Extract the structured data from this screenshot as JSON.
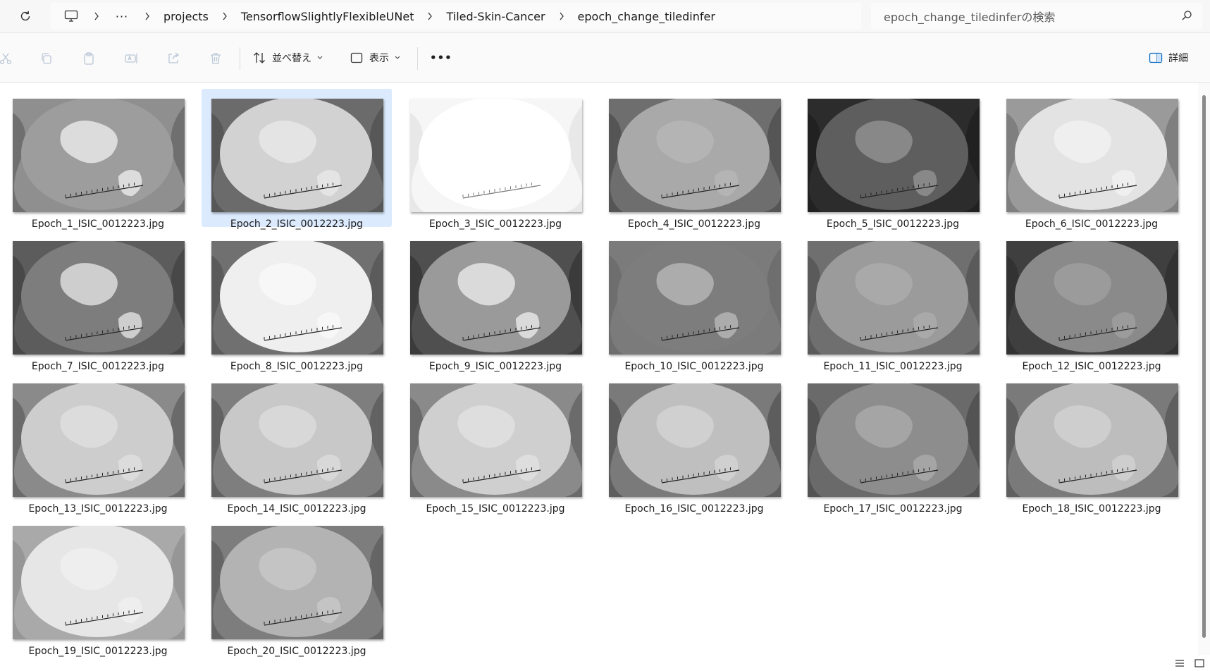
{
  "breadcrumb": {
    "overflow": "···",
    "items": [
      "projects",
      "TensorflowSlightlyFlexibleUNet",
      "Tiled-Skin-Cancer",
      "epoch_change_tiledinfer"
    ]
  },
  "search": {
    "placeholder": "epoch_change_tiledinferの検索"
  },
  "toolbar": {
    "sort_label": "並べ替え",
    "view_label": "表示",
    "more_label": "•••",
    "details_label": "詳細"
  },
  "files": [
    {
      "name": "Epoch_1_ISIC_0012223.jpg",
      "style": "e1"
    },
    {
      "name": "Epoch_2_ISIC_0012223.jpg",
      "style": "e2",
      "selected": true
    },
    {
      "name": "Epoch_3_ISIC_0012223.jpg",
      "style": "e3"
    },
    {
      "name": "Epoch_4_ISIC_0012223.jpg",
      "style": "e4"
    },
    {
      "name": "Epoch_5_ISIC_0012223.jpg",
      "style": "e5"
    },
    {
      "name": "Epoch_6_ISIC_0012223.jpg",
      "style": "e6"
    },
    {
      "name": "Epoch_7_ISIC_0012223.jpg",
      "style": "e7"
    },
    {
      "name": "Epoch_8_ISIC_0012223.jpg",
      "style": "e8"
    },
    {
      "name": "Epoch_9_ISIC_0012223.jpg",
      "style": "e9"
    },
    {
      "name": "Epoch_10_ISIC_0012223.jpg",
      "style": "e10"
    },
    {
      "name": "Epoch_11_ISIC_0012223.jpg",
      "style": "e11"
    },
    {
      "name": "Epoch_12_ISIC_0012223.jpg",
      "style": "e12"
    },
    {
      "name": "Epoch_13_ISIC_0012223.jpg",
      "style": "e13"
    },
    {
      "name": "Epoch_14_ISIC_0012223.jpg",
      "style": "e14"
    },
    {
      "name": "Epoch_15_ISIC_0012223.jpg",
      "style": "e15"
    },
    {
      "name": "Epoch_16_ISIC_0012223.jpg",
      "style": "e16"
    },
    {
      "name": "Epoch_17_ISIC_0012223.jpg",
      "style": "e17"
    },
    {
      "name": "Epoch_18_ISIC_0012223.jpg",
      "style": "e18"
    },
    {
      "name": "Epoch_19_ISIC_0012223.jpg",
      "style": "e19"
    },
    {
      "name": "Epoch_20_ISIC_0012223.jpg",
      "style": "e20"
    }
  ],
  "colors": {
    "selection": "#dbeafc",
    "accent": "#0067c0"
  }
}
